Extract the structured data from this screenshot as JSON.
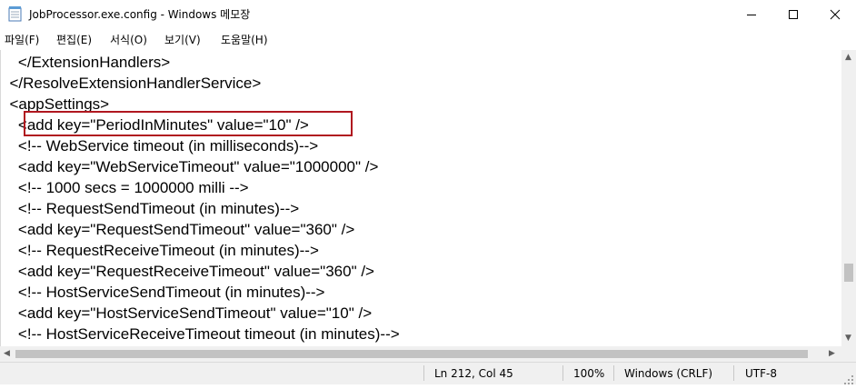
{
  "window": {
    "title": "JobProcessor.exe.config - Windows 메모장",
    "icon": "notepad-icon",
    "controls": {
      "minimize": "minimize-icon",
      "maximize": "maximize-icon",
      "close": "close-icon"
    }
  },
  "menu": [
    {
      "label": "파일(F)"
    },
    {
      "label": "편집(E)"
    },
    {
      "label": "서식(O)"
    },
    {
      "label": "보기(V)"
    },
    {
      "label": "도움말(H)"
    }
  ],
  "editor": {
    "lines": [
      "    </ExtensionHandlers>",
      "  </ResolveExtensionHandlerService>",
      "  <appSettings>",
      "    <add key=\"PeriodInMinutes\" value=\"10\" />",
      "    <!-- WebService timeout (in milliseconds)-->",
      "    <add key=\"WebServiceTimeout\" value=\"1000000\" />",
      "    <!-- 1000 secs = 1000000 milli -->",
      "    <!-- RequestSendTimeout (in minutes)-->",
      "    <add key=\"RequestSendTimeout\" value=\"360\" />",
      "    <!-- RequestReceiveTimeout (in minutes)-->",
      "    <add key=\"RequestReceiveTimeout\" value=\"360\" />",
      "    <!-- HostServiceSendTimeout (in minutes)-->",
      "    <add key=\"HostServiceSendTimeout\" value=\"10\" />",
      "    <!-- HostServiceReceiveTimeout timeout (in minutes)-->"
    ],
    "highlight_color": "#b0171f"
  },
  "status": {
    "position": "Ln 212, Col 45",
    "zoom": "100%",
    "line_ending": "Windows (CRLF)",
    "encoding": "UTF-8"
  },
  "colors": {
    "status_bar": "#f0f0f0",
    "highlight": "#b0171f"
  }
}
